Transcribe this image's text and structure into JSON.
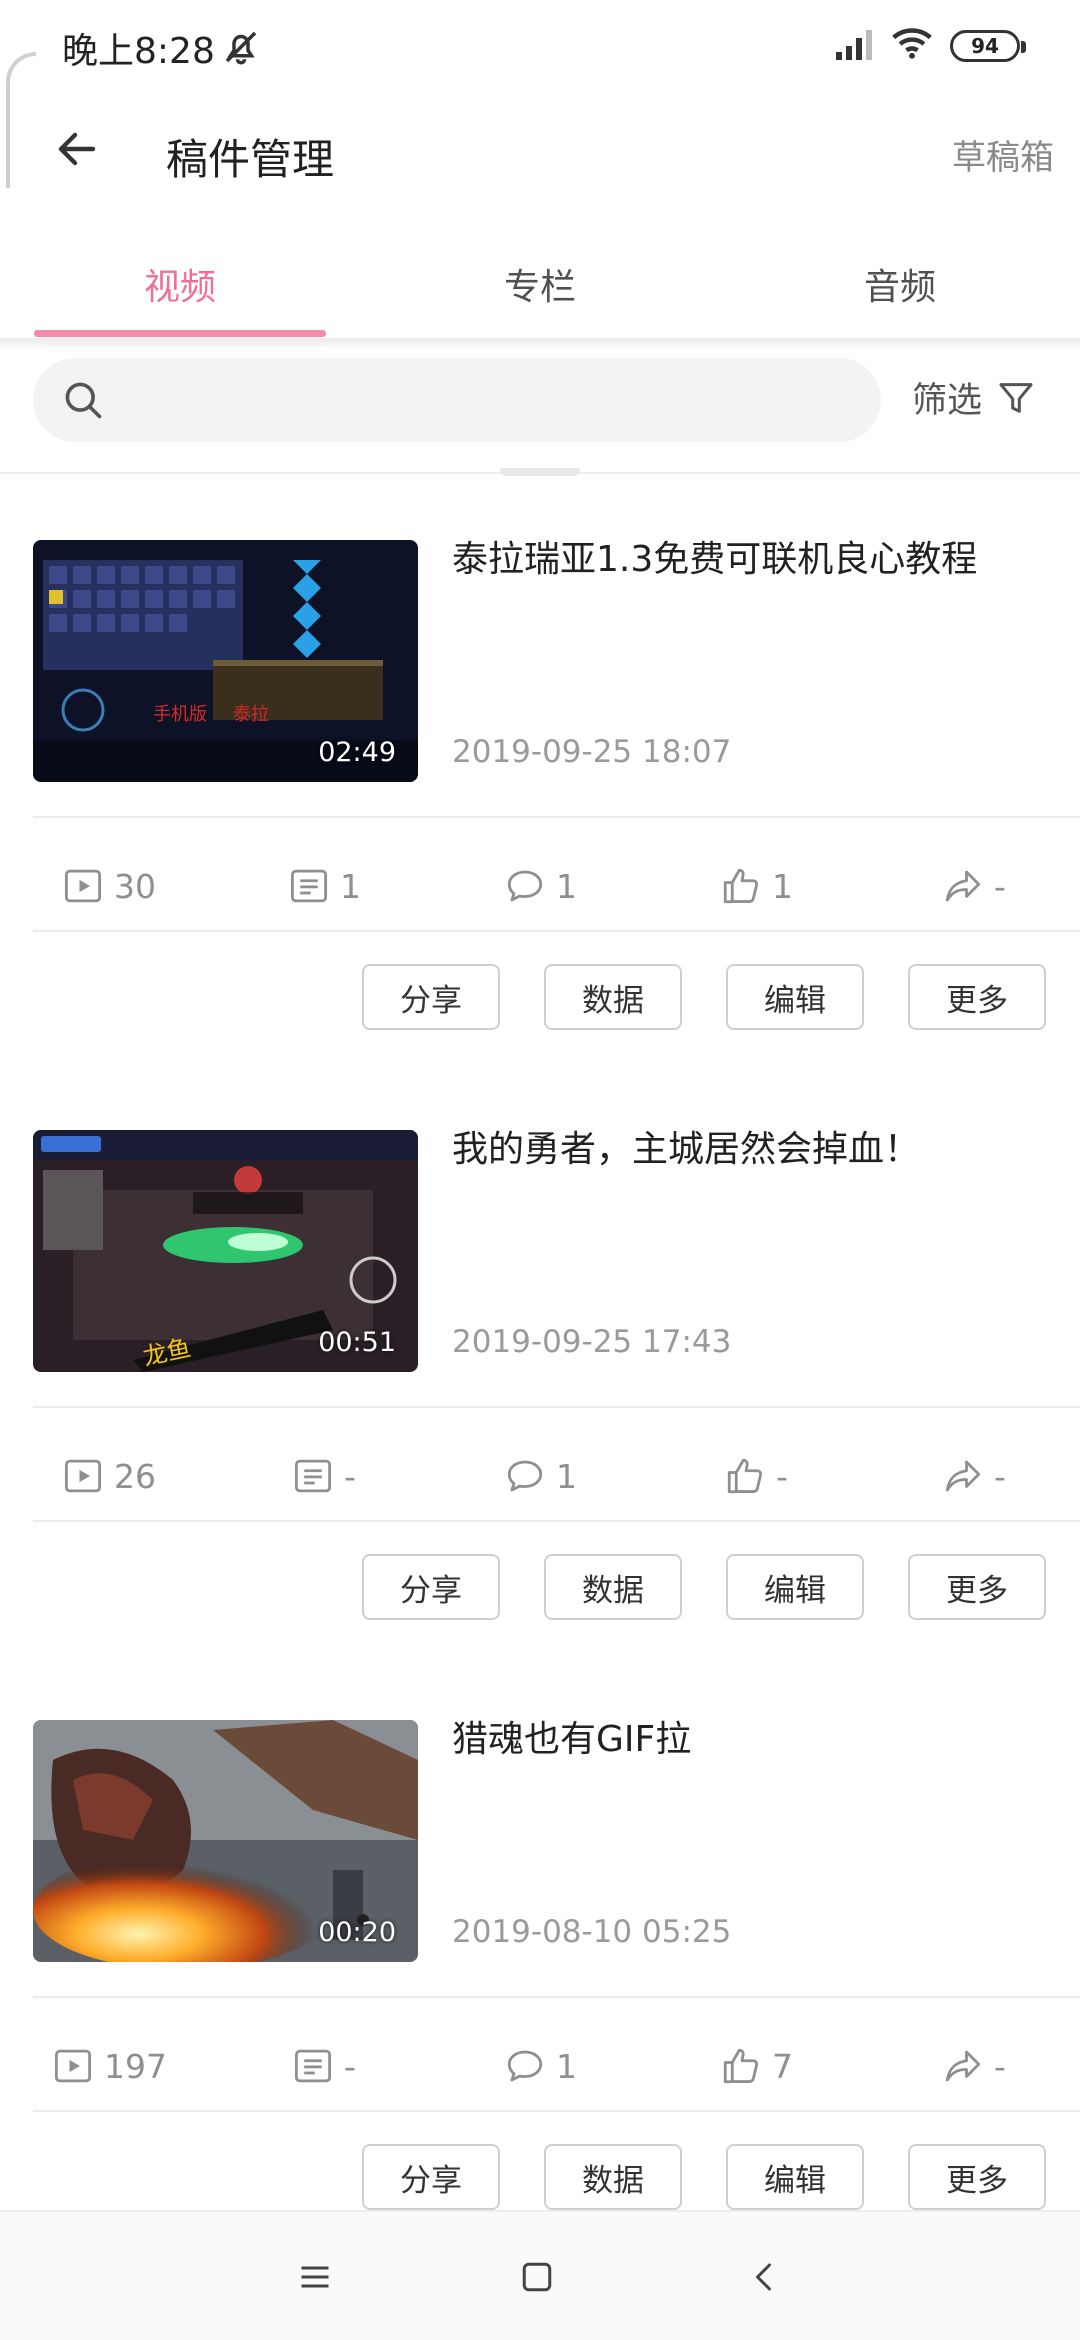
{
  "status_bar": {
    "time": "晚上8:28",
    "battery": "94"
  },
  "header": {
    "title": "稿件管理",
    "drafts": "草稿箱"
  },
  "tabs": [
    {
      "label": "视频",
      "active": true
    },
    {
      "label": "专栏",
      "active": false
    },
    {
      "label": "音频",
      "active": false
    }
  ],
  "search": {
    "placeholder": "",
    "filter_label": "筛选"
  },
  "actions": {
    "share": "分享",
    "data": "数据",
    "edit": "编辑",
    "more": "更多"
  },
  "videos": [
    {
      "title": "泰拉瑞亚1.3免费可联机良心教程",
      "date": "2019-09-25 18:07",
      "duration": "02:49",
      "stats": {
        "plays": "30",
        "danmaku": "1",
        "comments": "1",
        "likes": "1",
        "shares": "-"
      }
    },
    {
      "title": "我的勇者，主城居然会掉血！",
      "date": "2019-09-25 17:43",
      "duration": "00:51",
      "stats": {
        "plays": "26",
        "danmaku": "-",
        "comments": "1",
        "likes": "-",
        "shares": "-"
      }
    },
    {
      "title": "猎魂也有GIF拉",
      "date": "2019-08-10 05:25",
      "duration": "00:20",
      "stats": {
        "plays": "197",
        "danmaku": "-",
        "comments": "1",
        "likes": "7",
        "shares": "-"
      }
    }
  ],
  "colors": {
    "accent": "#f06f96",
    "indicator": "#f58bab",
    "muted": "#8f8f8f"
  },
  "icons": [
    "back-arrow-icon",
    "search-icon",
    "filter-icon",
    "play-icon",
    "danmaku-icon",
    "comment-icon",
    "like-icon",
    "share-icon",
    "menu-icon",
    "home-icon",
    "back-nav-icon"
  ]
}
